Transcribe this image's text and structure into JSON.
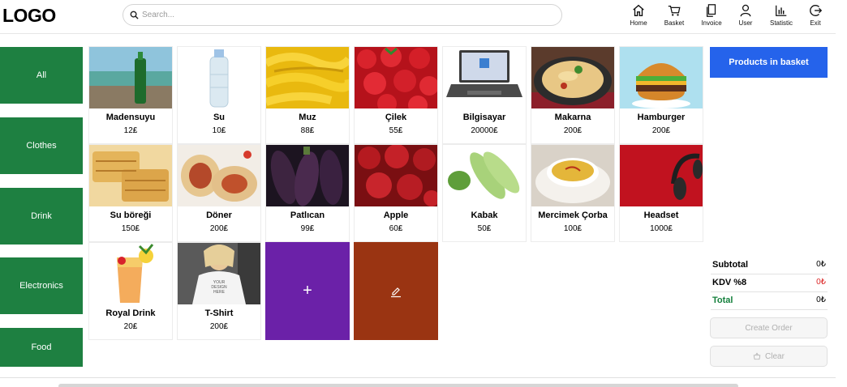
{
  "header": {
    "logo": "LOGO",
    "search_placeholder": "Search...",
    "nav": [
      {
        "label": "Home",
        "icon": "home-icon"
      },
      {
        "label": "Basket",
        "icon": "cart-icon"
      },
      {
        "label": "Invoice",
        "icon": "invoice-icon"
      },
      {
        "label": "User",
        "icon": "user-icon"
      },
      {
        "label": "Statistic",
        "icon": "statistic-icon"
      },
      {
        "label": "Exit",
        "icon": "exit-icon"
      }
    ]
  },
  "categories": [
    "All",
    "Clothes",
    "Drink",
    "Electronics",
    "Food"
  ],
  "products": [
    {
      "name": "Madensuyu",
      "price": "12₤"
    },
    {
      "name": "Su",
      "price": "10₤"
    },
    {
      "name": "Muz",
      "price": "88₤"
    },
    {
      "name": "Çilek",
      "price": "55₤"
    },
    {
      "name": "Bilgisayar",
      "price": "20000₤"
    },
    {
      "name": "Makarna",
      "price": "200₤"
    },
    {
      "name": "Hamburger",
      "price": "200₤"
    },
    {
      "name": "Su böreği",
      "price": "150₤"
    },
    {
      "name": "Döner",
      "price": "200₤"
    },
    {
      "name": "Patlıcan",
      "price": "99₤"
    },
    {
      "name": "Apple",
      "price": "60₤"
    },
    {
      "name": "Kabak",
      "price": "50₤"
    },
    {
      "name": "Mercimek Çorba",
      "price": "100₤"
    },
    {
      "name": "Headset",
      "price": "1000₤"
    },
    {
      "name": "Royal Drink",
      "price": "20₤"
    },
    {
      "name": "T-Shirt",
      "price": "200₤"
    }
  ],
  "tshirt_print": [
    "YOUR",
    "DESIGN",
    "HERE"
  ],
  "actions": {
    "add_symbol": "+",
    "add_color": "#6b21a8",
    "edit_color": "#9a3412"
  },
  "basket": {
    "button_label": "Products in basket",
    "subtotal_label": "Subtotal",
    "subtotal_value": "0₺",
    "kdv_label": "KDV %8",
    "kdv_value": "0₺",
    "total_label": "Total",
    "total_value": "0₺",
    "create_order_label": "Create Order",
    "clear_label": "Clear"
  },
  "colors": {
    "category": "#1e8041",
    "basket_button": "#2563eb",
    "total": "#15803d",
    "kdv": "#dc2626"
  }
}
